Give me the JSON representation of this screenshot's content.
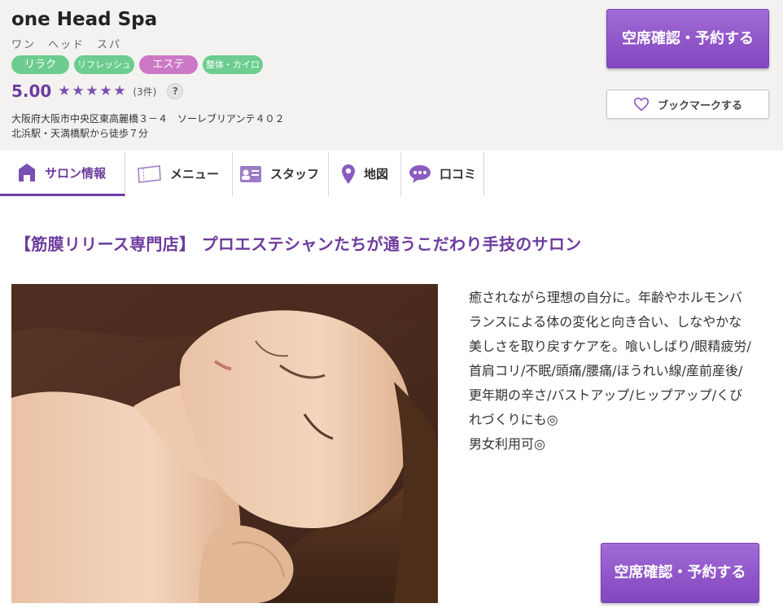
{
  "header": {
    "salon_name": "one Head Spa",
    "salon_kana": "ワン　ヘッド　スパ",
    "tags": [
      {
        "label": "リラク",
        "color": "#6ccd8e"
      },
      {
        "label": "リフレッシュ",
        "color": "#6ccd8e"
      },
      {
        "label": "エステ",
        "color": "#cc78c7"
      },
      {
        "label": "整体・カイロ",
        "color": "#6ccd8e"
      }
    ],
    "rating": {
      "score": "5.00",
      "stars": 5,
      "count": "(3件)",
      "help": "?"
    },
    "address": "大阪府大阪市中央区東高麗橋３－４　ソーレブリアンテ４０２",
    "access": "北浜駅・天満橋駅から徒歩７分",
    "reserve_label": "空席確認・予約する",
    "bookmark_label": "ブックマークする"
  },
  "tabs": [
    {
      "label": "サロン情報",
      "icon": "home-icon",
      "active": true
    },
    {
      "label": "メニュー",
      "icon": "ticket-icon",
      "active": false
    },
    {
      "label": "スタッフ",
      "icon": "staff-card-icon",
      "active": false
    },
    {
      "label": "地図",
      "icon": "map-pin-icon",
      "active": false
    },
    {
      "label": "口コミ",
      "icon": "chat-bubble-icon",
      "active": false
    }
  ],
  "main": {
    "catch_copy": "【筋膜リリース専門店】 プロエステシャンたちが通うこだわり手技のサロン",
    "description": "癒されながら理想の自分に。年齢やホルモンバランスによる体の変化と向き合い、しなやかな美しさを取り戻すケアを。喰いしばり/眼精疲労/首肩コリ/不眠/頭痛/腰痛/ほうれい線/産前産後/更年期の辛さ/バストアップ/ヒップアップ/くびれづくりにも◎",
    "description_line2": "男女利用可◎",
    "reserve_label": "空席確認・予約する"
  },
  "colors": {
    "accent": "#6d3c9e",
    "button": "#8f57cb",
    "tag_green": "#6ccd8e",
    "tag_pink": "#cc78c7"
  }
}
